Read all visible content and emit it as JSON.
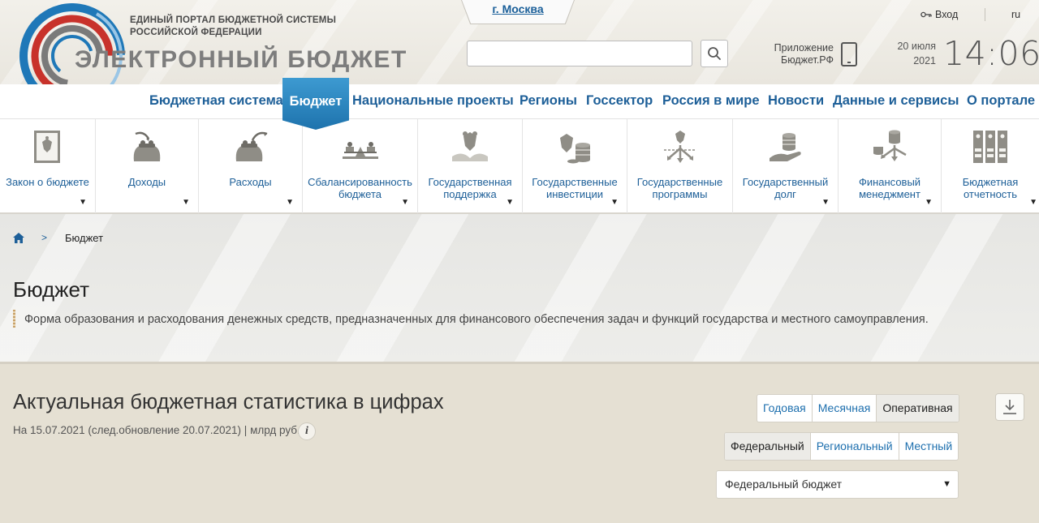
{
  "header": {
    "logo_top_line1": "ЕДИНЫЙ ПОРТАЛ БЮДЖЕТНОЙ СИСТЕМЫ",
    "logo_top_line2": "РОССИЙСКОЙ ФЕДЕРАЦИИ",
    "logo_main": "ЭЛЕКТРОННЫЙ БЮДЖЕТ",
    "city": "г. Москва",
    "search_placeholder": "",
    "app_line1": "Приложение",
    "app_line2": "Бюджет.РФ",
    "date_line1": "20 июля",
    "date_line2": "2021",
    "time": "14:06",
    "login": "Вход",
    "lang": "ru"
  },
  "topnav": {
    "items": [
      "Бюджетная система",
      "Бюджет",
      "Национальные проекты",
      "Регионы",
      "Госсектор",
      "Россия в мире",
      "Новости",
      "Данные и сервисы",
      "О портале"
    ],
    "active": "Бюджет"
  },
  "submenu": {
    "items": [
      {
        "label": "Закон о бюджете",
        "icon": "law-book-icon"
      },
      {
        "label": "Доходы",
        "icon": "income-purse-icon"
      },
      {
        "label": "Расходы",
        "icon": "expense-purse-icon"
      },
      {
        "label": "Сбалансированность бюджета",
        "icon": "balance-scale-icon"
      },
      {
        "label": "Государственная поддержка",
        "icon": "state-support-icon"
      },
      {
        "label": "Государственные инвестиции",
        "icon": "investment-coins-icon"
      },
      {
        "label": "Государственные программы",
        "icon": "programs-arrows-icon"
      },
      {
        "label": "Государственный долг",
        "icon": "debt-hand-coins-icon"
      },
      {
        "label": "Финансовый менеджмент",
        "icon": "finance-management-icon"
      },
      {
        "label": "Бюджетная отчетность",
        "icon": "reports-binders-icon"
      }
    ]
  },
  "breadcrumb": {
    "separator": ">",
    "current": "Бюджет"
  },
  "page": {
    "title": "Бюджет",
    "description": "Форма образования и расходования денежных средств, предназначенных для финансового обеспечения задач и функций государства и местного самоуправления."
  },
  "stats": {
    "title": "Актуальная бюджетная статистика в цифрах",
    "subtitle": "На 15.07.2021 (след.обновление 20.07.2021) | млрд руб.",
    "info": "i",
    "period_tabs": [
      "Годовая",
      "Месячная",
      "Оперативная"
    ],
    "period_active": "Оперативная",
    "level_tabs": [
      "Федеральный",
      "Региональный",
      "Местный"
    ],
    "level_active": "Федеральный",
    "budget_select": "Федеральный бюджет"
  },
  "colors": {
    "link_blue": "#1d5f98",
    "active_tab": "#2a86c2",
    "icon_gray": "#8b8a84"
  }
}
